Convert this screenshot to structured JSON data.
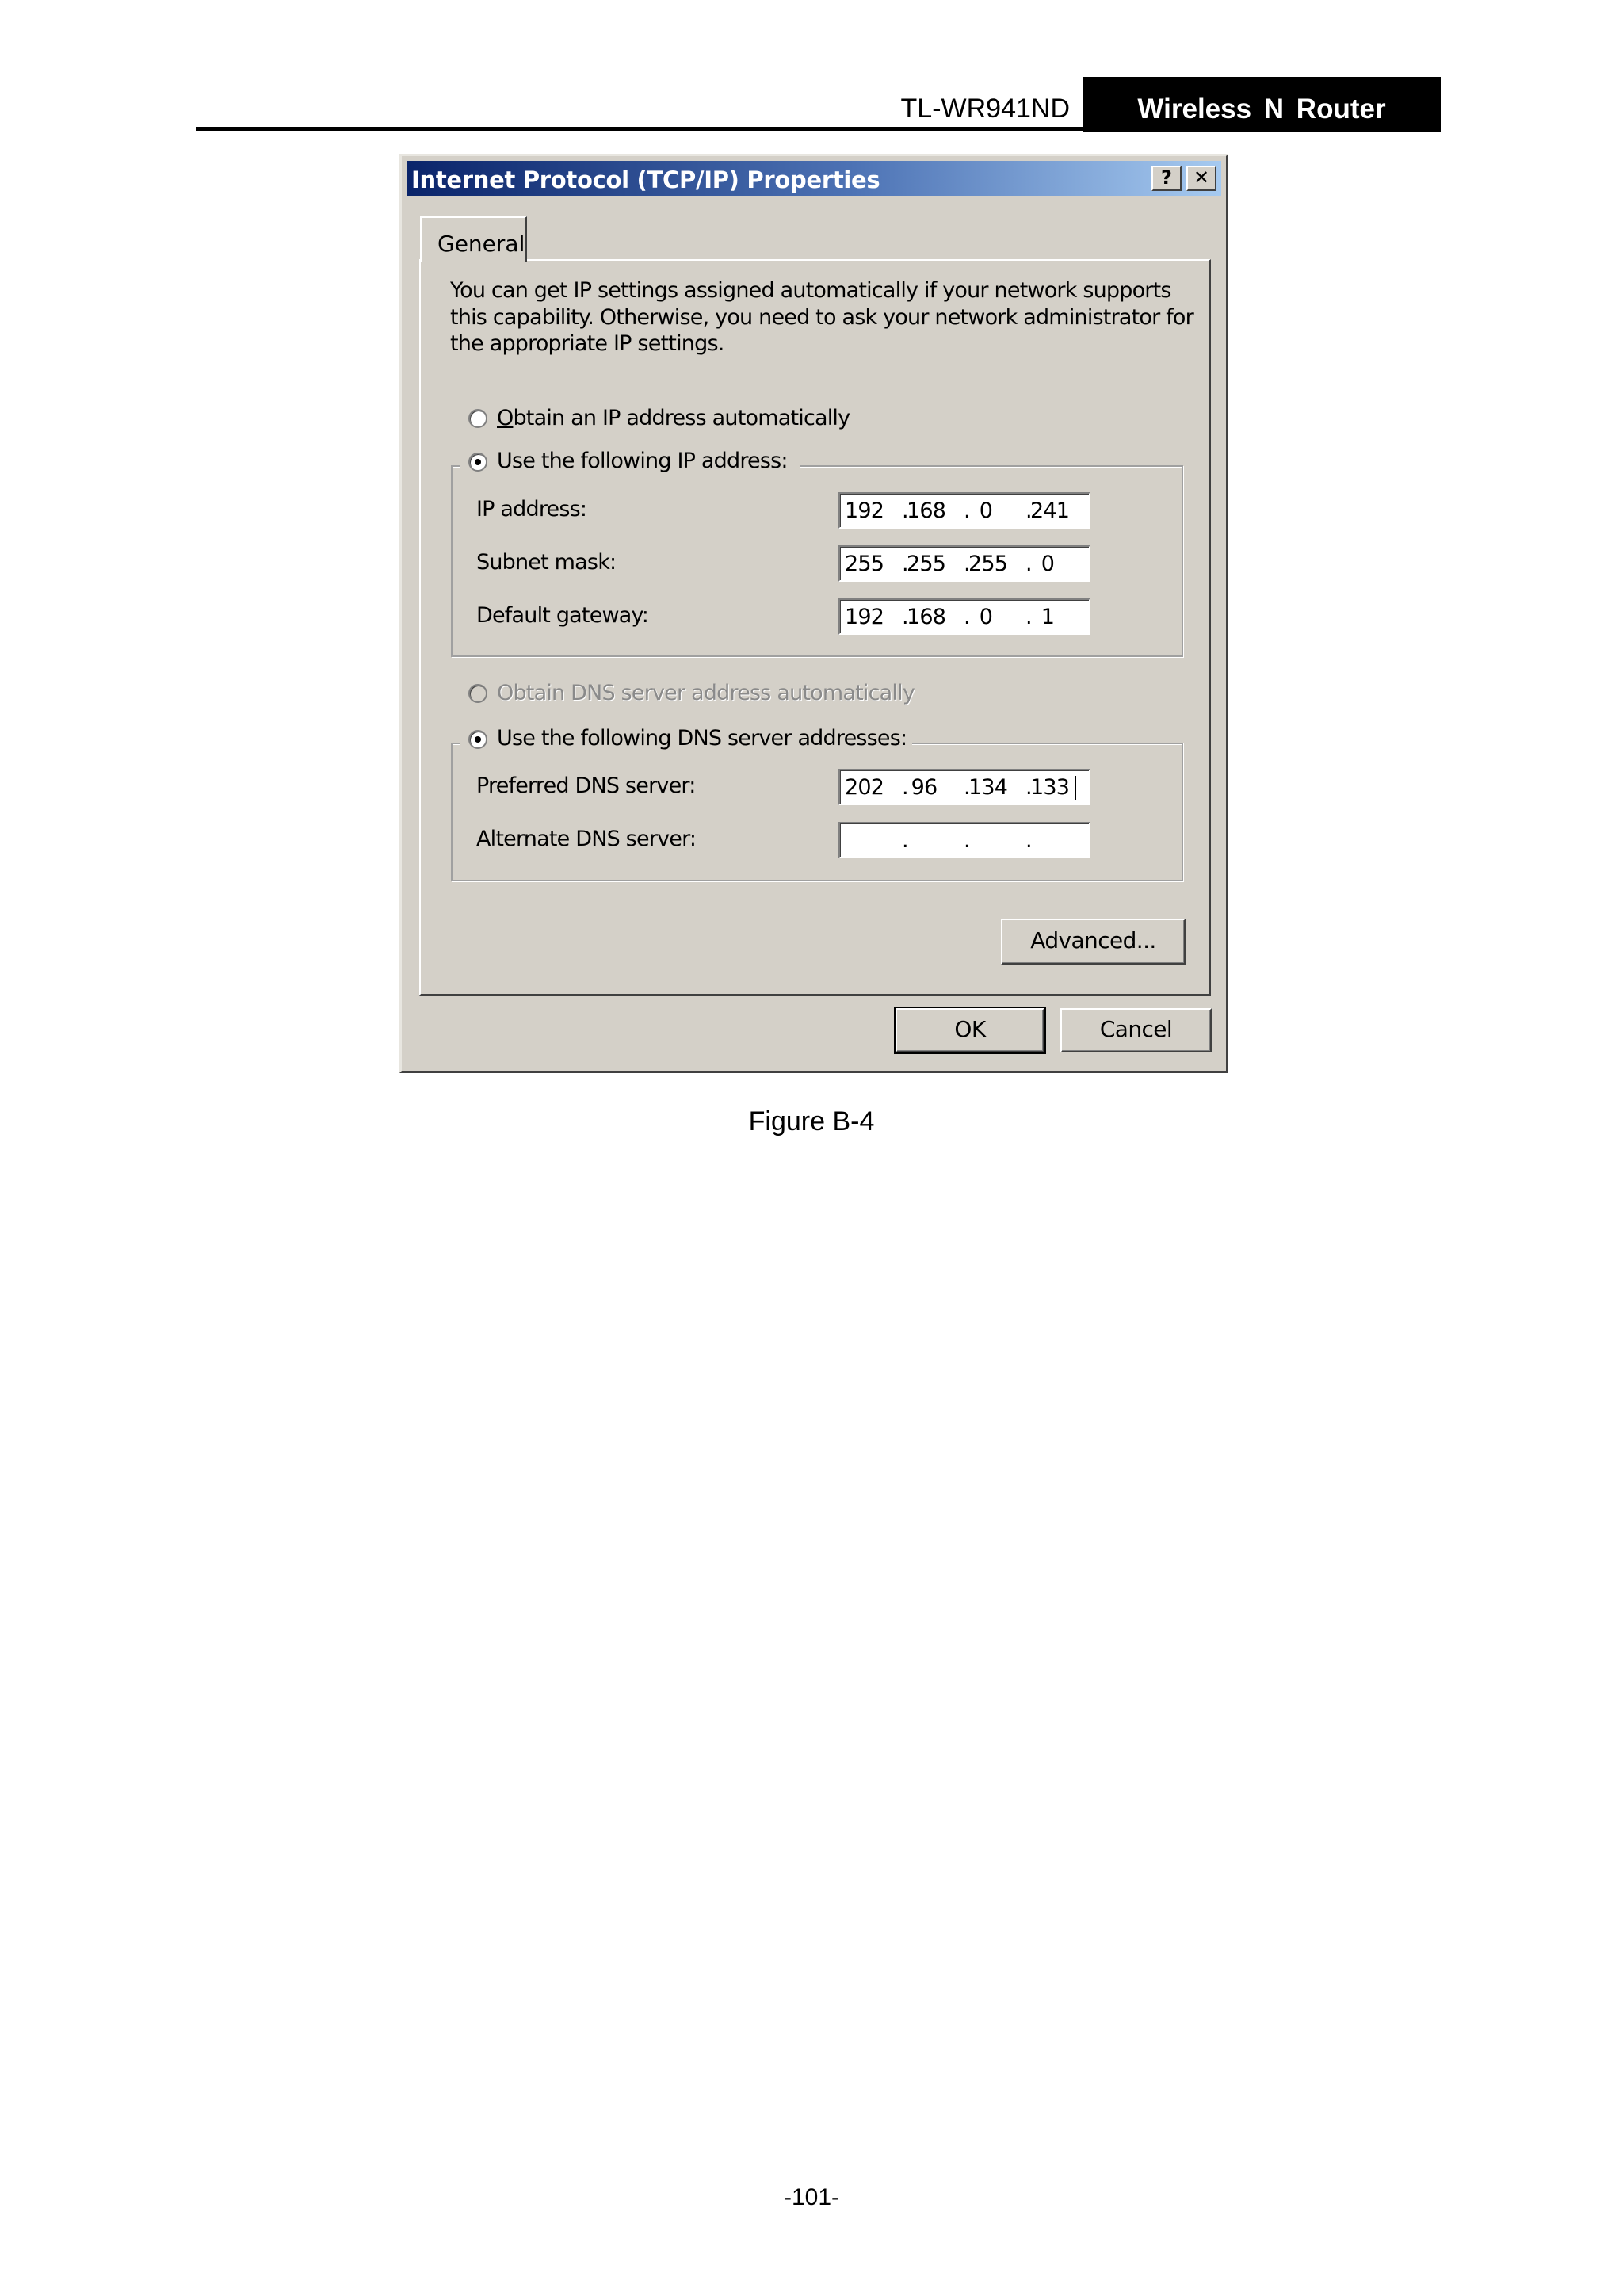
{
  "header": {
    "model": "TL-WR941ND",
    "product": "Wireless  N  Router"
  },
  "dialog": {
    "title": "Internet Protocol (TCP/IP) Properties",
    "help_symbol": "?",
    "close_symbol": "✕",
    "tab": "General",
    "intro": [
      "You can get IP settings assigned automatically if your network supports",
      "this capability. Otherwise, you need to ask your network administrator for",
      "the appropriate IP settings."
    ],
    "ip_auto": {
      "label": "Obtain an IP address automatically",
      "checked": false
    },
    "ip_manual": {
      "label": "Use the following IP address:",
      "checked": true
    },
    "ip_address": {
      "label": "IP address:",
      "octets": [
        "192",
        "168",
        "0",
        "241"
      ]
    },
    "subnet_mask": {
      "label": "Subnet mask:",
      "octets": [
        "255",
        "255",
        "255",
        "0"
      ]
    },
    "gateway": {
      "label": "Default gateway:",
      "octets": [
        "192",
        "168",
        "0",
        "1"
      ]
    },
    "dns_auto": {
      "label": "Obtain DNS server address automatically",
      "checked": false,
      "disabled": true
    },
    "dns_manual": {
      "label": "Use the following DNS server addresses:",
      "checked": true
    },
    "preferred_dns": {
      "label": "Preferred DNS server:",
      "octets": [
        "202",
        "96",
        "134",
        "133"
      ]
    },
    "alternate_dns": {
      "label": "Alternate DNS server:",
      "octets": [
        "",
        "",
        "",
        ""
      ]
    },
    "advanced_label": "Advanced...",
    "ok_label": "OK",
    "cancel_label": "Cancel"
  },
  "caption": "Figure B-4",
  "page_number": "-101-"
}
